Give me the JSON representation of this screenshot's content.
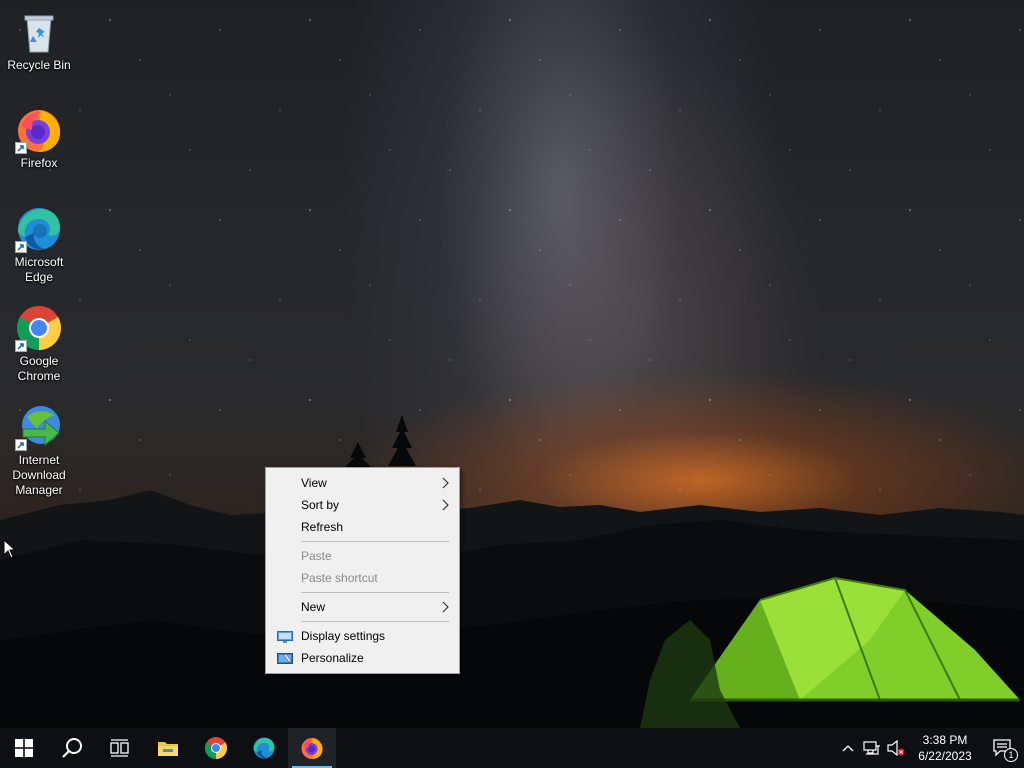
{
  "desktop": {
    "icons": [
      {
        "label": "Recycle Bin",
        "icon": "recycle-bin-icon"
      },
      {
        "label": "Firefox",
        "icon": "firefox-icon"
      },
      {
        "label": "Microsoft Edge",
        "icon": "edge-icon"
      },
      {
        "label": "Google Chrome",
        "icon": "chrome-icon"
      },
      {
        "label": "Internet Download Manager",
        "icon": "idm-icon"
      }
    ]
  },
  "context_menu": {
    "items": [
      {
        "label": "View",
        "submenu": true,
        "enabled": true
      },
      {
        "label": "Sort by",
        "submenu": true,
        "enabled": true
      },
      {
        "label": "Refresh",
        "submenu": false,
        "enabled": true
      },
      {
        "label": "Paste",
        "submenu": false,
        "enabled": false
      },
      {
        "label": "Paste shortcut",
        "submenu": false,
        "enabled": false
      },
      {
        "label": "New",
        "submenu": true,
        "enabled": true
      },
      {
        "label": "Display settings",
        "submenu": false,
        "enabled": true,
        "icon": "display-settings-icon"
      },
      {
        "label": "Personalize",
        "submenu": false,
        "enabled": true,
        "icon": "personalize-icon"
      }
    ]
  },
  "taskbar": {
    "apps": [
      "start-icon",
      "search-icon",
      "task-view-icon",
      "file-explorer-icon",
      "chrome-icon",
      "edge-icon",
      "firefox-icon"
    ],
    "clock": {
      "time": "3:38 PM",
      "date": "6/22/2023"
    },
    "notification_count": "1",
    "accent_color": "#76b9ed"
  }
}
